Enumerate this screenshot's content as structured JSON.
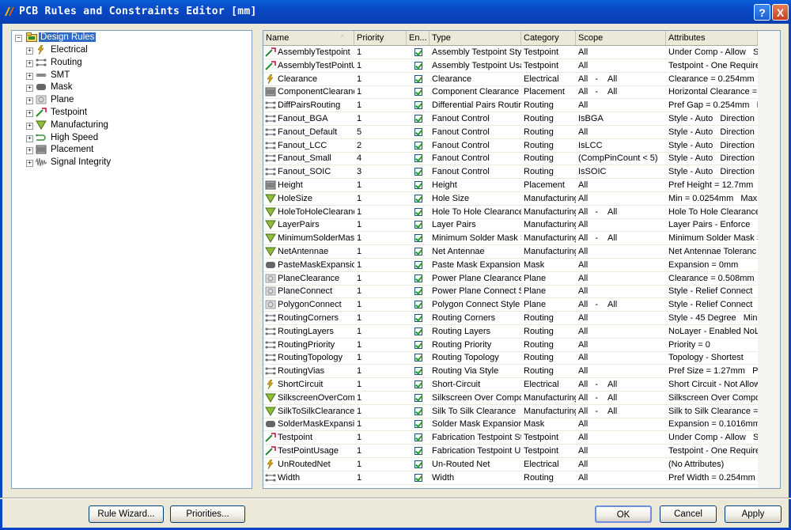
{
  "window": {
    "title": "PCB Rules and Constraints Editor [mm]",
    "help_label": "?",
    "close_label": "X"
  },
  "tree": {
    "root": {
      "label": "Design Rules",
      "icon": "design-rules-folder-icon",
      "expander": "−"
    },
    "items": [
      {
        "label": "Electrical",
        "icon": "electrical-icon",
        "expander": "+"
      },
      {
        "label": "Routing",
        "icon": "routing-icon",
        "expander": "+"
      },
      {
        "label": "SMT",
        "icon": "smt-icon",
        "expander": "+"
      },
      {
        "label": "Mask",
        "icon": "mask-icon",
        "expander": "+"
      },
      {
        "label": "Plane",
        "icon": "plane-icon",
        "expander": "+"
      },
      {
        "label": "Testpoint",
        "icon": "testpoint-icon",
        "expander": "+"
      },
      {
        "label": "Manufacturing",
        "icon": "manufacturing-icon",
        "expander": "+"
      },
      {
        "label": "High Speed",
        "icon": "high-speed-icon",
        "expander": "+"
      },
      {
        "label": "Placement",
        "icon": "placement-icon",
        "expander": "+"
      },
      {
        "label": "Signal Integrity",
        "icon": "signal-integrity-icon",
        "expander": "+"
      }
    ]
  },
  "table": {
    "columns": [
      "Name",
      "Priority",
      "En...",
      "Type",
      "Category",
      "Scope",
      "Attributes"
    ],
    "sort_indicator": "^",
    "rows": [
      {
        "icon": "testpoint-icon",
        "name": "AssemblyTestpoint",
        "priority": "1",
        "enabled": true,
        "type": "Assembly Testpoint Styl",
        "category": "Testpoint",
        "scope": "All",
        "scope2": "",
        "attributes": "Under Comp - Allow   S"
      },
      {
        "icon": "testpoint-icon",
        "name": "AssemblyTestPointU",
        "priority": "1",
        "enabled": true,
        "type": "Assembly Testpoint Usa",
        "category": "Testpoint",
        "scope": "All",
        "scope2": "",
        "attributes": "Testpoint - One Require"
      },
      {
        "icon": "electrical-icon",
        "name": "Clearance",
        "priority": "1",
        "enabled": true,
        "type": "Clearance",
        "category": "Electrical",
        "scope": "All   -",
        "scope2": "All",
        "attributes": "Clearance = 0.254mm"
      },
      {
        "icon": "placement-icon",
        "name": "ComponentClearanc",
        "priority": "1",
        "enabled": true,
        "type": "Component Clearance",
        "category": "Placement",
        "scope": "All   -",
        "scope2": "All",
        "attributes": "Horizontal Clearance = 0"
      },
      {
        "icon": "routing-icon",
        "name": "DiffPairsRouting",
        "priority": "1",
        "enabled": true,
        "type": "Differential Pairs Routin",
        "category": "Routing",
        "scope": "All",
        "scope2": "",
        "attributes": "Pref Gap = 0.254mm   M"
      },
      {
        "icon": "routing-icon",
        "name": "Fanout_BGA",
        "priority": "1",
        "enabled": true,
        "type": "Fanout Control",
        "category": "Routing",
        "scope": "IsBGA",
        "scope2": "",
        "attributes": "Style - Auto   Direction"
      },
      {
        "icon": "routing-icon",
        "name": "Fanout_Default",
        "priority": "5",
        "enabled": true,
        "type": "Fanout Control",
        "category": "Routing",
        "scope": "All",
        "scope2": "",
        "attributes": "Style - Auto   Direction"
      },
      {
        "icon": "routing-icon",
        "name": "Fanout_LCC",
        "priority": "2",
        "enabled": true,
        "type": "Fanout Control",
        "category": "Routing",
        "scope": "IsLCC",
        "scope2": "",
        "attributes": "Style - Auto   Direction"
      },
      {
        "icon": "routing-icon",
        "name": "Fanout_Small",
        "priority": "4",
        "enabled": true,
        "type": "Fanout Control",
        "category": "Routing",
        "scope": "(CompPinCount < 5)",
        "scope2": "",
        "attributes": "Style - Auto   Direction"
      },
      {
        "icon": "routing-icon",
        "name": "Fanout_SOIC",
        "priority": "3",
        "enabled": true,
        "type": "Fanout Control",
        "category": "Routing",
        "scope": "IsSOIC",
        "scope2": "",
        "attributes": "Style - Auto   Direction"
      },
      {
        "icon": "placement-icon",
        "name": "Height",
        "priority": "1",
        "enabled": true,
        "type": "Height",
        "category": "Placement",
        "scope": "All",
        "scope2": "",
        "attributes": "Pref Height = 12.7mm"
      },
      {
        "icon": "manufacturing-icon",
        "name": "HoleSize",
        "priority": "1",
        "enabled": true,
        "type": "Hole Size",
        "category": "Manufacturing",
        "scope": "All",
        "scope2": "",
        "attributes": "Min = 0.0254mm   Max"
      },
      {
        "icon": "manufacturing-icon",
        "name": "HoleToHoleClearanc",
        "priority": "1",
        "enabled": true,
        "type": "Hole To Hole Clearance",
        "category": "Manufacturing",
        "scope": "All   -",
        "scope2": "All",
        "attributes": "Hole To Hole Clearance"
      },
      {
        "icon": "manufacturing-icon",
        "name": "LayerPairs",
        "priority": "1",
        "enabled": true,
        "type": "Layer Pairs",
        "category": "Manufacturing",
        "scope": "All",
        "scope2": "",
        "attributes": "Layer Pairs - Enforce"
      },
      {
        "icon": "manufacturing-icon",
        "name": "MinimumSolderMask",
        "priority": "1",
        "enabled": true,
        "type": "Minimum Solder Mask S",
        "category": "Manufacturing",
        "scope": "All   -",
        "scope2": "All",
        "attributes": "Minimum Solder Mask S"
      },
      {
        "icon": "manufacturing-icon",
        "name": "NetAntennae",
        "priority": "1",
        "enabled": true,
        "type": "Net Antennae",
        "category": "Manufacturing",
        "scope": "All",
        "scope2": "",
        "attributes": "Net Antennae Toleranc"
      },
      {
        "icon": "mask-icon",
        "name": "PasteMaskExpansio",
        "priority": "1",
        "enabled": true,
        "type": "Paste Mask Expansion",
        "category": "Mask",
        "scope": "All",
        "scope2": "",
        "attributes": "Expansion = 0mm"
      },
      {
        "icon": "plane-icon",
        "name": "PlaneClearance",
        "priority": "1",
        "enabled": true,
        "type": "Power Plane Clearance",
        "category": "Plane",
        "scope": "All",
        "scope2": "",
        "attributes": "Clearance = 0.508mm"
      },
      {
        "icon": "plane-icon",
        "name": "PlaneConnect",
        "priority": "1",
        "enabled": true,
        "type": "Power Plane Connect S",
        "category": "Plane",
        "scope": "All",
        "scope2": "",
        "attributes": "Style - Relief Connect"
      },
      {
        "icon": "plane-icon",
        "name": "PolygonConnect",
        "priority": "1",
        "enabled": true,
        "type": "Polygon Connect Style",
        "category": "Plane",
        "scope": "All   -",
        "scope2": "All",
        "attributes": "Style - Relief Connect"
      },
      {
        "icon": "routing-icon",
        "name": "RoutingCorners",
        "priority": "1",
        "enabled": true,
        "type": "Routing Corners",
        "category": "Routing",
        "scope": "All",
        "scope2": "",
        "attributes": "Style - 45 Degree   Min"
      },
      {
        "icon": "routing-icon",
        "name": "RoutingLayers",
        "priority": "1",
        "enabled": true,
        "type": "Routing Layers",
        "category": "Routing",
        "scope": "All",
        "scope2": "",
        "attributes": "NoLayer - Enabled NoL"
      },
      {
        "icon": "routing-icon",
        "name": "RoutingPriority",
        "priority": "1",
        "enabled": true,
        "type": "Routing Priority",
        "category": "Routing",
        "scope": "All",
        "scope2": "",
        "attributes": "Priority = 0"
      },
      {
        "icon": "routing-icon",
        "name": "RoutingTopology",
        "priority": "1",
        "enabled": true,
        "type": "Routing Topology",
        "category": "Routing",
        "scope": "All",
        "scope2": "",
        "attributes": "Topology - Shortest"
      },
      {
        "icon": "routing-icon",
        "name": "RoutingVias",
        "priority": "1",
        "enabled": true,
        "type": "Routing Via Style",
        "category": "Routing",
        "scope": "All",
        "scope2": "",
        "attributes": "Pref Size = 1.27mm   Pr"
      },
      {
        "icon": "electrical-icon",
        "name": "ShortCircuit",
        "priority": "1",
        "enabled": true,
        "type": "Short-Circuit",
        "category": "Electrical",
        "scope": "All   -",
        "scope2": "All",
        "attributes": "Short Circuit - Not Allow"
      },
      {
        "icon": "manufacturing-icon",
        "name": "SilkscreenOverComp",
        "priority": "1",
        "enabled": true,
        "type": "Silkscreen Over Compo",
        "category": "Manufacturing",
        "scope": "All   -",
        "scope2": "All",
        "attributes": "Silkscreen Over Compo"
      },
      {
        "icon": "manufacturing-icon",
        "name": "SilkToSilkClearance",
        "priority": "1",
        "enabled": true,
        "type": "Silk To Silk Clearance",
        "category": "Manufacturing",
        "scope": "All   -",
        "scope2": "All",
        "attributes": "Silk to Silk Clearance ="
      },
      {
        "icon": "mask-icon",
        "name": "SolderMaskExpansic",
        "priority": "1",
        "enabled": true,
        "type": "Solder Mask Expansion",
        "category": "Mask",
        "scope": "All",
        "scope2": "",
        "attributes": "Expansion = 0.1016mm"
      },
      {
        "icon": "testpoint-icon",
        "name": "Testpoint",
        "priority": "1",
        "enabled": true,
        "type": "Fabrication Testpoint St",
        "category": "Testpoint",
        "scope": "All",
        "scope2": "",
        "attributes": "Under Comp - Allow   S"
      },
      {
        "icon": "testpoint-icon",
        "name": "TestPointUsage",
        "priority": "1",
        "enabled": true,
        "type": "Fabrication Testpoint U:",
        "category": "Testpoint",
        "scope": "All",
        "scope2": "",
        "attributes": "Testpoint - One Require"
      },
      {
        "icon": "electrical-icon",
        "name": "UnRoutedNet",
        "priority": "1",
        "enabled": true,
        "type": "Un-Routed Net",
        "category": "Electrical",
        "scope": "All",
        "scope2": "",
        "attributes": "(No Attributes)"
      },
      {
        "icon": "routing-icon",
        "name": "Width",
        "priority": "1",
        "enabled": true,
        "type": "Width",
        "category": "Routing",
        "scope": "All",
        "scope2": "",
        "attributes": "Pref Width = 0.254mm"
      }
    ]
  },
  "buttons": {
    "rule_wizard": "Rule Wizard...",
    "priorities": "Priorities...",
    "ok": "OK",
    "cancel": "Cancel",
    "apply": "Apply"
  }
}
